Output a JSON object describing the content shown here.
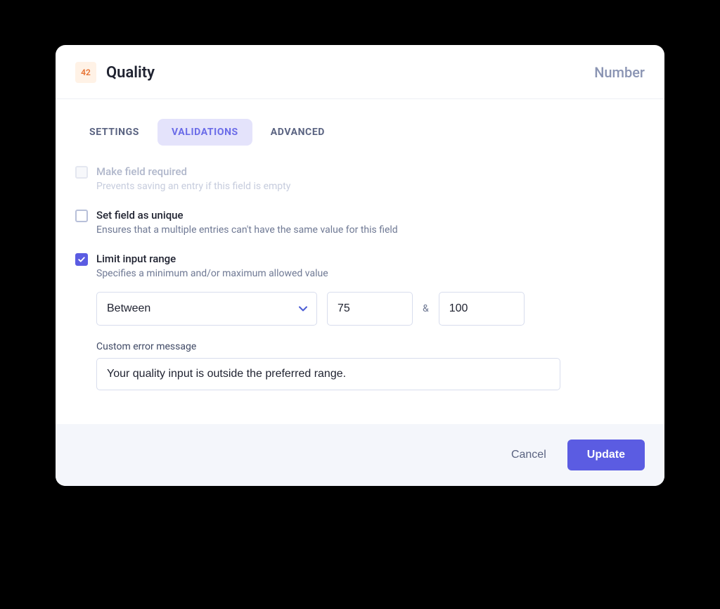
{
  "header": {
    "icon_text": "42",
    "title": "Quality",
    "type_label": "Number"
  },
  "tabs": {
    "settings": "SETTINGS",
    "validations": "VALIDATIONS",
    "advanced": "ADVANCED"
  },
  "options": {
    "required": {
      "label": "Make field required",
      "desc": "Prevents saving an entry if this field is empty"
    },
    "unique": {
      "label": "Set field as unique",
      "desc": "Ensures that a multiple entries can't have the same value for this field"
    },
    "limit": {
      "label": "Limit input range",
      "desc": "Specifies a minimum and/or maximum allowed value"
    }
  },
  "range": {
    "mode": "Between",
    "min": "75",
    "amp": "&",
    "max": "100"
  },
  "error": {
    "label": "Custom error message",
    "value": "Your quality input is outside the preferred range."
  },
  "footer": {
    "cancel": "Cancel",
    "update": "Update"
  }
}
